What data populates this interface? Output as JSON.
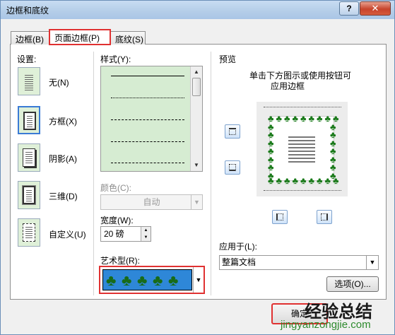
{
  "window": {
    "title": "边框和底纹",
    "help": "?",
    "close": "✕"
  },
  "tabs": [
    {
      "label": "边框(B)"
    },
    {
      "label": "页面边框(P)"
    },
    {
      "label": "底纹(S)"
    }
  ],
  "settings": {
    "heading": "设置:",
    "items": [
      {
        "label": "无(N)"
      },
      {
        "label": "方框(X)"
      },
      {
        "label": "阴影(A)"
      },
      {
        "label": "三维(D)"
      },
      {
        "label": "自定义(U)"
      }
    ]
  },
  "style": {
    "label": "样式(Y):"
  },
  "color": {
    "label": "颜色(C):",
    "value": "自动"
  },
  "width": {
    "label": "宽度(W):",
    "value": "20 磅"
  },
  "art": {
    "label": "艺术型(R):"
  },
  "preview": {
    "heading": "预览",
    "hint_line1": "单击下方图示或使用按钮可",
    "hint_line2": "应用边框"
  },
  "apply_to": {
    "label": "应用于(L):",
    "value": "整篇文档"
  },
  "buttons": {
    "options": "选项(O)...",
    "ok": "确定"
  },
  "watermark": {
    "text": "经验总结",
    "url": "jingyanzongjie.com"
  },
  "colors": {
    "accent_red": "#e03131",
    "list_green": "#d6ecd2",
    "art_blue": "#2e87d8",
    "tree_green": "#186b18"
  }
}
